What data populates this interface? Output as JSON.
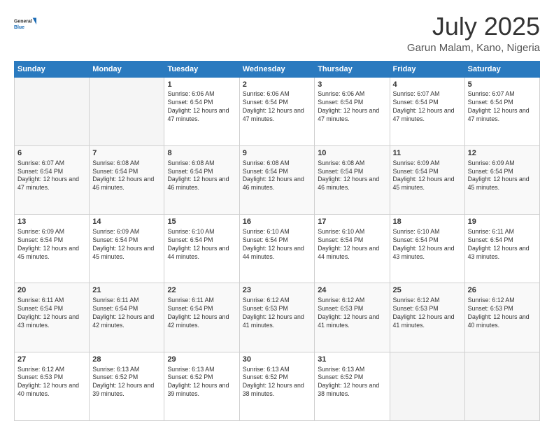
{
  "header": {
    "logo_general": "General",
    "logo_blue": "Blue",
    "title": "July 2025",
    "subtitle": "Garun Malam, Kano, Nigeria"
  },
  "days_of_week": [
    "Sunday",
    "Monday",
    "Tuesday",
    "Wednesday",
    "Thursday",
    "Friday",
    "Saturday"
  ],
  "weeks": [
    [
      {
        "day": "",
        "sunrise": "",
        "sunset": "",
        "daylight": "",
        "empty": true
      },
      {
        "day": "",
        "sunrise": "",
        "sunset": "",
        "daylight": "",
        "empty": true
      },
      {
        "day": "1",
        "sunrise": "Sunrise: 6:06 AM",
        "sunset": "Sunset: 6:54 PM",
        "daylight": "Daylight: 12 hours and 47 minutes.",
        "empty": false
      },
      {
        "day": "2",
        "sunrise": "Sunrise: 6:06 AM",
        "sunset": "Sunset: 6:54 PM",
        "daylight": "Daylight: 12 hours and 47 minutes.",
        "empty": false
      },
      {
        "day": "3",
        "sunrise": "Sunrise: 6:06 AM",
        "sunset": "Sunset: 6:54 PM",
        "daylight": "Daylight: 12 hours and 47 minutes.",
        "empty": false
      },
      {
        "day": "4",
        "sunrise": "Sunrise: 6:07 AM",
        "sunset": "Sunset: 6:54 PM",
        "daylight": "Daylight: 12 hours and 47 minutes.",
        "empty": false
      },
      {
        "day": "5",
        "sunrise": "Sunrise: 6:07 AM",
        "sunset": "Sunset: 6:54 PM",
        "daylight": "Daylight: 12 hours and 47 minutes.",
        "empty": false
      }
    ],
    [
      {
        "day": "6",
        "sunrise": "Sunrise: 6:07 AM",
        "sunset": "Sunset: 6:54 PM",
        "daylight": "Daylight: 12 hours and 47 minutes.",
        "empty": false
      },
      {
        "day": "7",
        "sunrise": "Sunrise: 6:08 AM",
        "sunset": "Sunset: 6:54 PM",
        "daylight": "Daylight: 12 hours and 46 minutes.",
        "empty": false
      },
      {
        "day": "8",
        "sunrise": "Sunrise: 6:08 AM",
        "sunset": "Sunset: 6:54 PM",
        "daylight": "Daylight: 12 hours and 46 minutes.",
        "empty": false
      },
      {
        "day": "9",
        "sunrise": "Sunrise: 6:08 AM",
        "sunset": "Sunset: 6:54 PM",
        "daylight": "Daylight: 12 hours and 46 minutes.",
        "empty": false
      },
      {
        "day": "10",
        "sunrise": "Sunrise: 6:08 AM",
        "sunset": "Sunset: 6:54 PM",
        "daylight": "Daylight: 12 hours and 46 minutes.",
        "empty": false
      },
      {
        "day": "11",
        "sunrise": "Sunrise: 6:09 AM",
        "sunset": "Sunset: 6:54 PM",
        "daylight": "Daylight: 12 hours and 45 minutes.",
        "empty": false
      },
      {
        "day": "12",
        "sunrise": "Sunrise: 6:09 AM",
        "sunset": "Sunset: 6:54 PM",
        "daylight": "Daylight: 12 hours and 45 minutes.",
        "empty": false
      }
    ],
    [
      {
        "day": "13",
        "sunrise": "Sunrise: 6:09 AM",
        "sunset": "Sunset: 6:54 PM",
        "daylight": "Daylight: 12 hours and 45 minutes.",
        "empty": false
      },
      {
        "day": "14",
        "sunrise": "Sunrise: 6:09 AM",
        "sunset": "Sunset: 6:54 PM",
        "daylight": "Daylight: 12 hours and 45 minutes.",
        "empty": false
      },
      {
        "day": "15",
        "sunrise": "Sunrise: 6:10 AM",
        "sunset": "Sunset: 6:54 PM",
        "daylight": "Daylight: 12 hours and 44 minutes.",
        "empty": false
      },
      {
        "day": "16",
        "sunrise": "Sunrise: 6:10 AM",
        "sunset": "Sunset: 6:54 PM",
        "daylight": "Daylight: 12 hours and 44 minutes.",
        "empty": false
      },
      {
        "day": "17",
        "sunrise": "Sunrise: 6:10 AM",
        "sunset": "Sunset: 6:54 PM",
        "daylight": "Daylight: 12 hours and 44 minutes.",
        "empty": false
      },
      {
        "day": "18",
        "sunrise": "Sunrise: 6:10 AM",
        "sunset": "Sunset: 6:54 PM",
        "daylight": "Daylight: 12 hours and 43 minutes.",
        "empty": false
      },
      {
        "day": "19",
        "sunrise": "Sunrise: 6:11 AM",
        "sunset": "Sunset: 6:54 PM",
        "daylight": "Daylight: 12 hours and 43 minutes.",
        "empty": false
      }
    ],
    [
      {
        "day": "20",
        "sunrise": "Sunrise: 6:11 AM",
        "sunset": "Sunset: 6:54 PM",
        "daylight": "Daylight: 12 hours and 43 minutes.",
        "empty": false
      },
      {
        "day": "21",
        "sunrise": "Sunrise: 6:11 AM",
        "sunset": "Sunset: 6:54 PM",
        "daylight": "Daylight: 12 hours and 42 minutes.",
        "empty": false
      },
      {
        "day": "22",
        "sunrise": "Sunrise: 6:11 AM",
        "sunset": "Sunset: 6:54 PM",
        "daylight": "Daylight: 12 hours and 42 minutes.",
        "empty": false
      },
      {
        "day": "23",
        "sunrise": "Sunrise: 6:12 AM",
        "sunset": "Sunset: 6:53 PM",
        "daylight": "Daylight: 12 hours and 41 minutes.",
        "empty": false
      },
      {
        "day": "24",
        "sunrise": "Sunrise: 6:12 AM",
        "sunset": "Sunset: 6:53 PM",
        "daylight": "Daylight: 12 hours and 41 minutes.",
        "empty": false
      },
      {
        "day": "25",
        "sunrise": "Sunrise: 6:12 AM",
        "sunset": "Sunset: 6:53 PM",
        "daylight": "Daylight: 12 hours and 41 minutes.",
        "empty": false
      },
      {
        "day": "26",
        "sunrise": "Sunrise: 6:12 AM",
        "sunset": "Sunset: 6:53 PM",
        "daylight": "Daylight: 12 hours and 40 minutes.",
        "empty": false
      }
    ],
    [
      {
        "day": "27",
        "sunrise": "Sunrise: 6:12 AM",
        "sunset": "Sunset: 6:53 PM",
        "daylight": "Daylight: 12 hours and 40 minutes.",
        "empty": false
      },
      {
        "day": "28",
        "sunrise": "Sunrise: 6:13 AM",
        "sunset": "Sunset: 6:52 PM",
        "daylight": "Daylight: 12 hours and 39 minutes.",
        "empty": false
      },
      {
        "day": "29",
        "sunrise": "Sunrise: 6:13 AM",
        "sunset": "Sunset: 6:52 PM",
        "daylight": "Daylight: 12 hours and 39 minutes.",
        "empty": false
      },
      {
        "day": "30",
        "sunrise": "Sunrise: 6:13 AM",
        "sunset": "Sunset: 6:52 PM",
        "daylight": "Daylight: 12 hours and 38 minutes.",
        "empty": false
      },
      {
        "day": "31",
        "sunrise": "Sunrise: 6:13 AM",
        "sunset": "Sunset: 6:52 PM",
        "daylight": "Daylight: 12 hours and 38 minutes.",
        "empty": false
      },
      {
        "day": "",
        "sunrise": "",
        "sunset": "",
        "daylight": "",
        "empty": true
      },
      {
        "day": "",
        "sunrise": "",
        "sunset": "",
        "daylight": "",
        "empty": true
      }
    ]
  ]
}
